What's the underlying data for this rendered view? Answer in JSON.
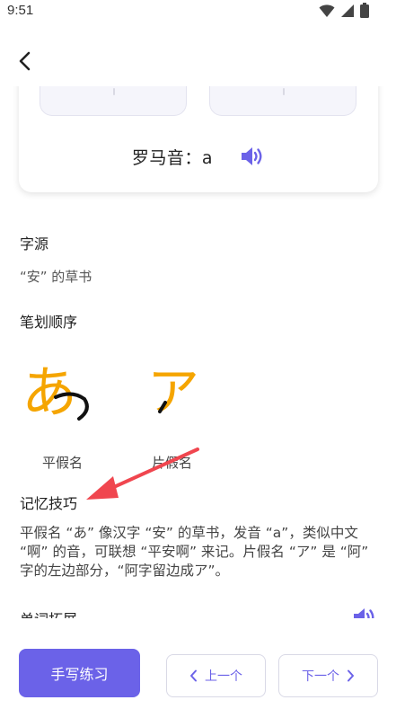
{
  "status": {
    "time": "9:51"
  },
  "card": {
    "romaji": "罗马音：a"
  },
  "source": {
    "title": "字源",
    "text": "“安” 的草书"
  },
  "stroke_order": {
    "title": "笔划顺序",
    "hiragana_char": "あ",
    "katakana_char": "ア",
    "hiragana_label": "平假名",
    "katakana_label": "片假名"
  },
  "memory": {
    "title": "记忆技巧",
    "lines": [
      "平假名 “あ” 像汉字 “安” 的草书，发音 “a”，类似中文",
      "“啊” 的音，可联想 “平安啊” 来记。片假名 “ア” 是 “阿”",
      "字的左边部分，“阿字留边成ア”。"
    ]
  },
  "vocab": {
    "title": "单词拓展"
  },
  "bottom": {
    "practice_label": "手写练习",
    "prev_label": "上一个",
    "next_label": "下一个"
  },
  "colors": {
    "accent": "#6b62e8",
    "stroke": "#f5a500",
    "annotation_arrow": "#f0464f"
  }
}
